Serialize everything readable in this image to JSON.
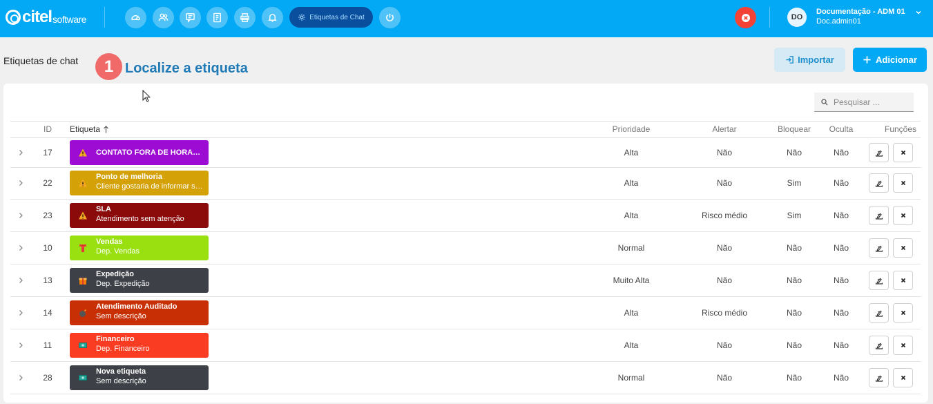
{
  "header": {
    "logo_brand": "citel",
    "logo_sub": "software",
    "active_nav_label": "Etiquetas de Chat",
    "avatar_initials": "DO",
    "user_name": "Documentação - ADM 01",
    "user_login": "Doc.admin01"
  },
  "page": {
    "title": "Etiquetas de chat",
    "step_number": "1",
    "step_text": "Localize a etiqueta",
    "import_label": "Importar",
    "add_label": "Adicionar"
  },
  "search": {
    "placeholder": "Pesquisar ..."
  },
  "table": {
    "columns": {
      "id": "ID",
      "etiqueta": "Etiqueta",
      "prioridade": "Prioridade",
      "alertar": "Alertar",
      "bloquear": "Bloquear",
      "oculta": "Oculta",
      "funcoes": "Funções"
    },
    "rows": [
      {
        "id": "17",
        "title": "CONTATO FORA DE HORARIO",
        "desc": "",
        "color": "#9c0cd3",
        "icon": "warning-icon",
        "icon_color": "#f5a623",
        "prioridade": "Alta",
        "alertar": "Não",
        "bloquear": "Não",
        "oculta": "Não"
      },
      {
        "id": "22",
        "title": "Ponto de melhoria",
        "desc": "Cliente gostaria de informar sobre",
        "color": "#d4a106",
        "icon": "warning-icon",
        "icon_color": "#f5a623",
        "prioridade": "Alta",
        "alertar": "Não",
        "bloquear": "Sim",
        "oculta": "Não"
      },
      {
        "id": "23",
        "title": "SLA",
        "desc": "Atendimento sem atenção",
        "color": "#8b0a0a",
        "icon": "warning-icon",
        "icon_color": "#f5a623",
        "prioridade": "Alta",
        "alertar": "Risco médio",
        "bloquear": "Sim",
        "oculta": "Não"
      },
      {
        "id": "10",
        "title": "Vendas",
        "desc": "Dep. Vendas",
        "color": "#9ae010",
        "icon": "t-icon",
        "icon_color": "#e53935",
        "prioridade": "Normal",
        "alertar": "Não",
        "bloquear": "Não",
        "oculta": "Não"
      },
      {
        "id": "13",
        "title": "Expedição",
        "desc": "Dep. Expedição",
        "color": "#3d4147",
        "icon": "gift-icon",
        "icon_color": "#f57c00",
        "prioridade": "Muito Alta",
        "alertar": "Não",
        "bloquear": "Não",
        "oculta": "Não"
      },
      {
        "id": "14",
        "title": "Atendimento Auditado",
        "desc": "Sem descrição",
        "color": "#c82f05",
        "icon": "bomb-icon",
        "icon_color": "#555555",
        "prioridade": "Alta",
        "alertar": "Risco médio",
        "bloquear": "Não",
        "oculta": "Não"
      },
      {
        "id": "11",
        "title": "Financeiro",
        "desc": "Dep. Financeiro",
        "color": "#fa3c22",
        "icon": "money-icon",
        "icon_color": "#26a69a",
        "prioridade": "Alta",
        "alertar": "Não",
        "bloquear": "Não",
        "oculta": "Não"
      },
      {
        "id": "28",
        "title": "Nova etiqueta",
        "desc": "Sem descrição",
        "color": "#3d4147",
        "icon": "money-icon",
        "icon_color": "#26a69a",
        "prioridade": "Normal",
        "alertar": "Não",
        "bloquear": "Não",
        "oculta": "Não"
      }
    ]
  },
  "colors": {
    "primary": "#03a9f4",
    "nav_active": "#0a4f9e",
    "danger": "#f44336",
    "step_badge": "#f06a6a",
    "step_text": "#1f7ab6"
  }
}
